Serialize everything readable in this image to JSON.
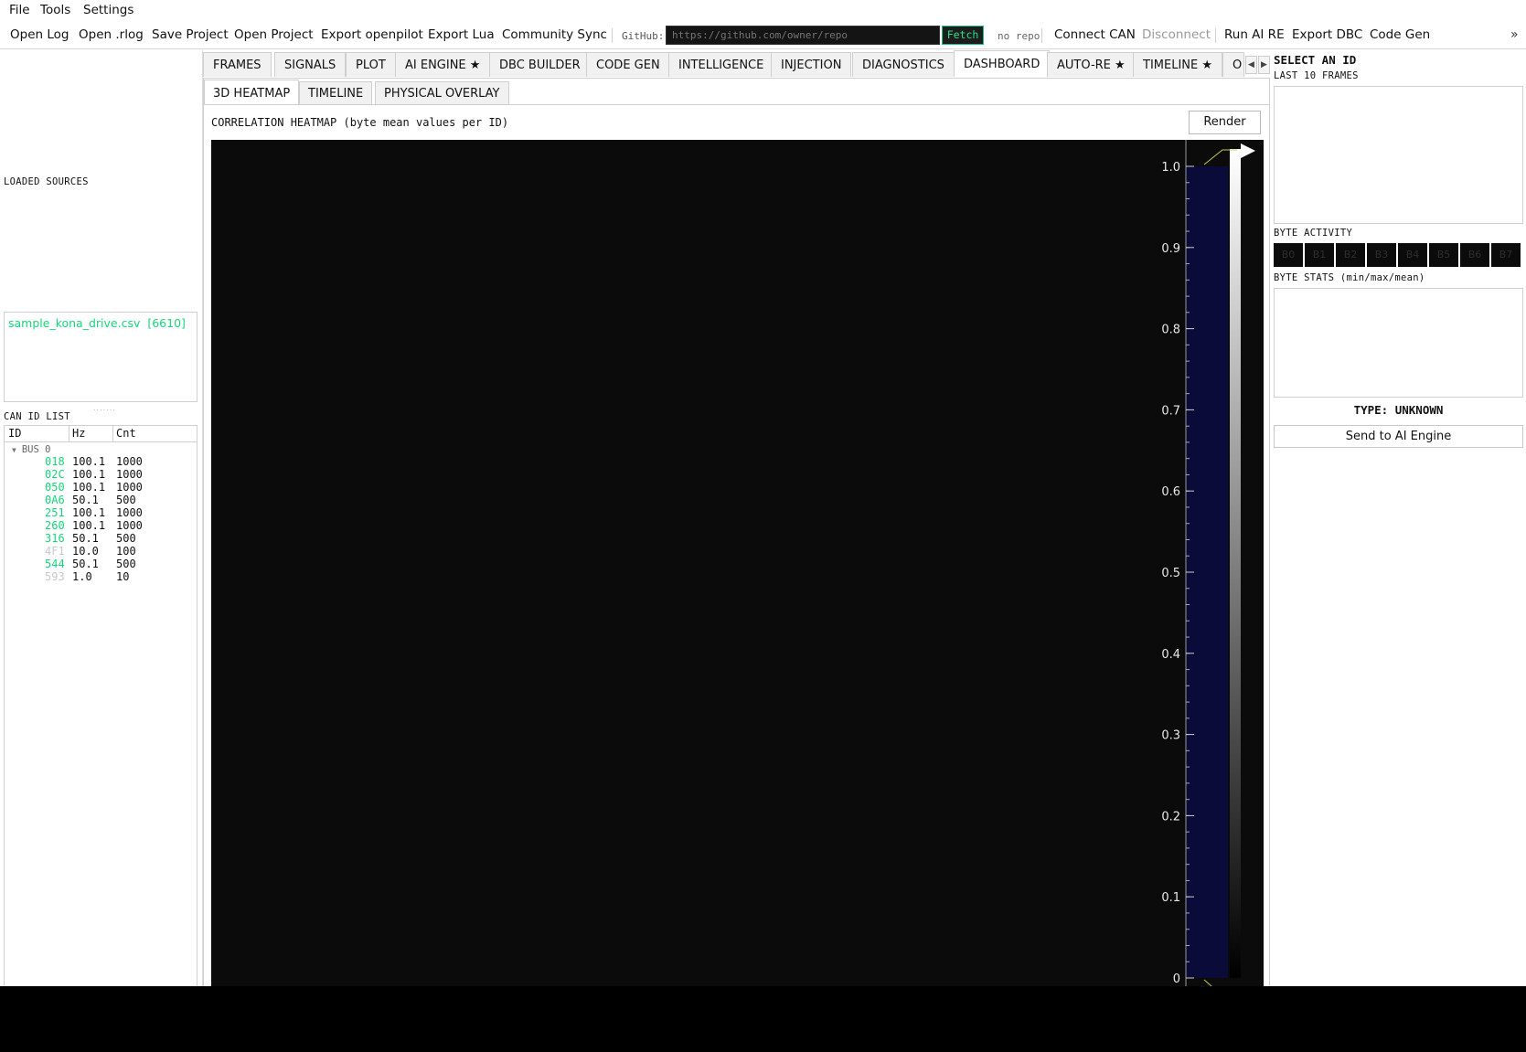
{
  "menu": [
    "File",
    "Tools",
    "Settings"
  ],
  "toolbar": {
    "buttons": [
      "Open Log",
      "Open .rlog",
      "Save Project",
      "Open Project",
      "Export openpilot",
      "Export Lua",
      "Community Sync"
    ],
    "github_label": "GitHub:",
    "github_placeholder": "https://github.com/owner/repo",
    "fetch": "Fetch",
    "repo_status": "no repo",
    "right_buttons": [
      "Connect CAN",
      "Disconnect",
      "Run AI RE",
      "Export DBC",
      "Code Gen"
    ],
    "overflow": "»"
  },
  "left": {
    "sources_label": "LOADED SOURCES",
    "sources": [
      {
        "name": "sample_kona_drive.csv",
        "count": "[6610]"
      }
    ],
    "can_id_label": "CAN ID LIST",
    "columns": [
      "ID",
      "Hz",
      "Cnt"
    ],
    "bus": "BUS 0",
    "rows": [
      {
        "id": "018",
        "hz": "100.1",
        "cnt": "1000",
        "active": true
      },
      {
        "id": "02C",
        "hz": "100.1",
        "cnt": "1000",
        "active": true
      },
      {
        "id": "050",
        "hz": "100.1",
        "cnt": "1000",
        "active": true
      },
      {
        "id": "0A6",
        "hz": "50.1",
        "cnt": "500",
        "active": true
      },
      {
        "id": "251",
        "hz": "100.1",
        "cnt": "1000",
        "active": true
      },
      {
        "id": "260",
        "hz": "100.1",
        "cnt": "1000",
        "active": true
      },
      {
        "id": "316",
        "hz": "50.1",
        "cnt": "500",
        "active": true
      },
      {
        "id": "4F1",
        "hz": "10.0",
        "cnt": "100",
        "active": false
      },
      {
        "id": "544",
        "hz": "50.1",
        "cnt": "500",
        "active": true
      },
      {
        "id": "593",
        "hz": "1.0",
        "cnt": "10",
        "active": false
      }
    ]
  },
  "main_tabs": [
    "FRAMES",
    "SIGNALS",
    "PLOT",
    "AI ENGINE ★",
    "DBC BUILDER",
    "CODE GEN",
    "INTELLIGENCE",
    "INJECTION",
    "DIAGNOSTICS",
    "DASHBOARD",
    "AUTO-RE ★",
    "TIMELINE ★",
    "O"
  ],
  "active_main_tab": "DASHBOARD",
  "sub_tabs": [
    "3D HEATMAP",
    "TIMELINE",
    "PHYSICAL OVERLAY"
  ],
  "active_sub_tab": "3D HEATMAP",
  "heatmap": {
    "title": "CORRELATION HEATMAP  (byte mean values per ID)",
    "render": "Render",
    "colorbar_ticks": [
      "1.0",
      "0.9",
      "0.8",
      "0.7",
      "0.6",
      "0.5",
      "0.4",
      "0.3",
      "0.2",
      "0.1",
      "0"
    ],
    "colorbar_range": [
      0,
      1.0
    ],
    "colormap_color": "#0b0b3a"
  },
  "right": {
    "title": "SELECT AN ID",
    "last_frames_label": "LAST 10 FRAMES",
    "byte_activity_label": "BYTE ACTIVITY",
    "bytes": [
      "B0",
      "B1",
      "B2",
      "B3",
      "B4",
      "B5",
      "B6",
      "B7"
    ],
    "byte_stats_label": "BYTE STATS (min/max/mean)",
    "type": "TYPE: UNKNOWN",
    "send": "Send to AI Engine"
  },
  "colors": {
    "accent_green": "#17d679",
    "inactive_id": "#c8c8c8"
  }
}
